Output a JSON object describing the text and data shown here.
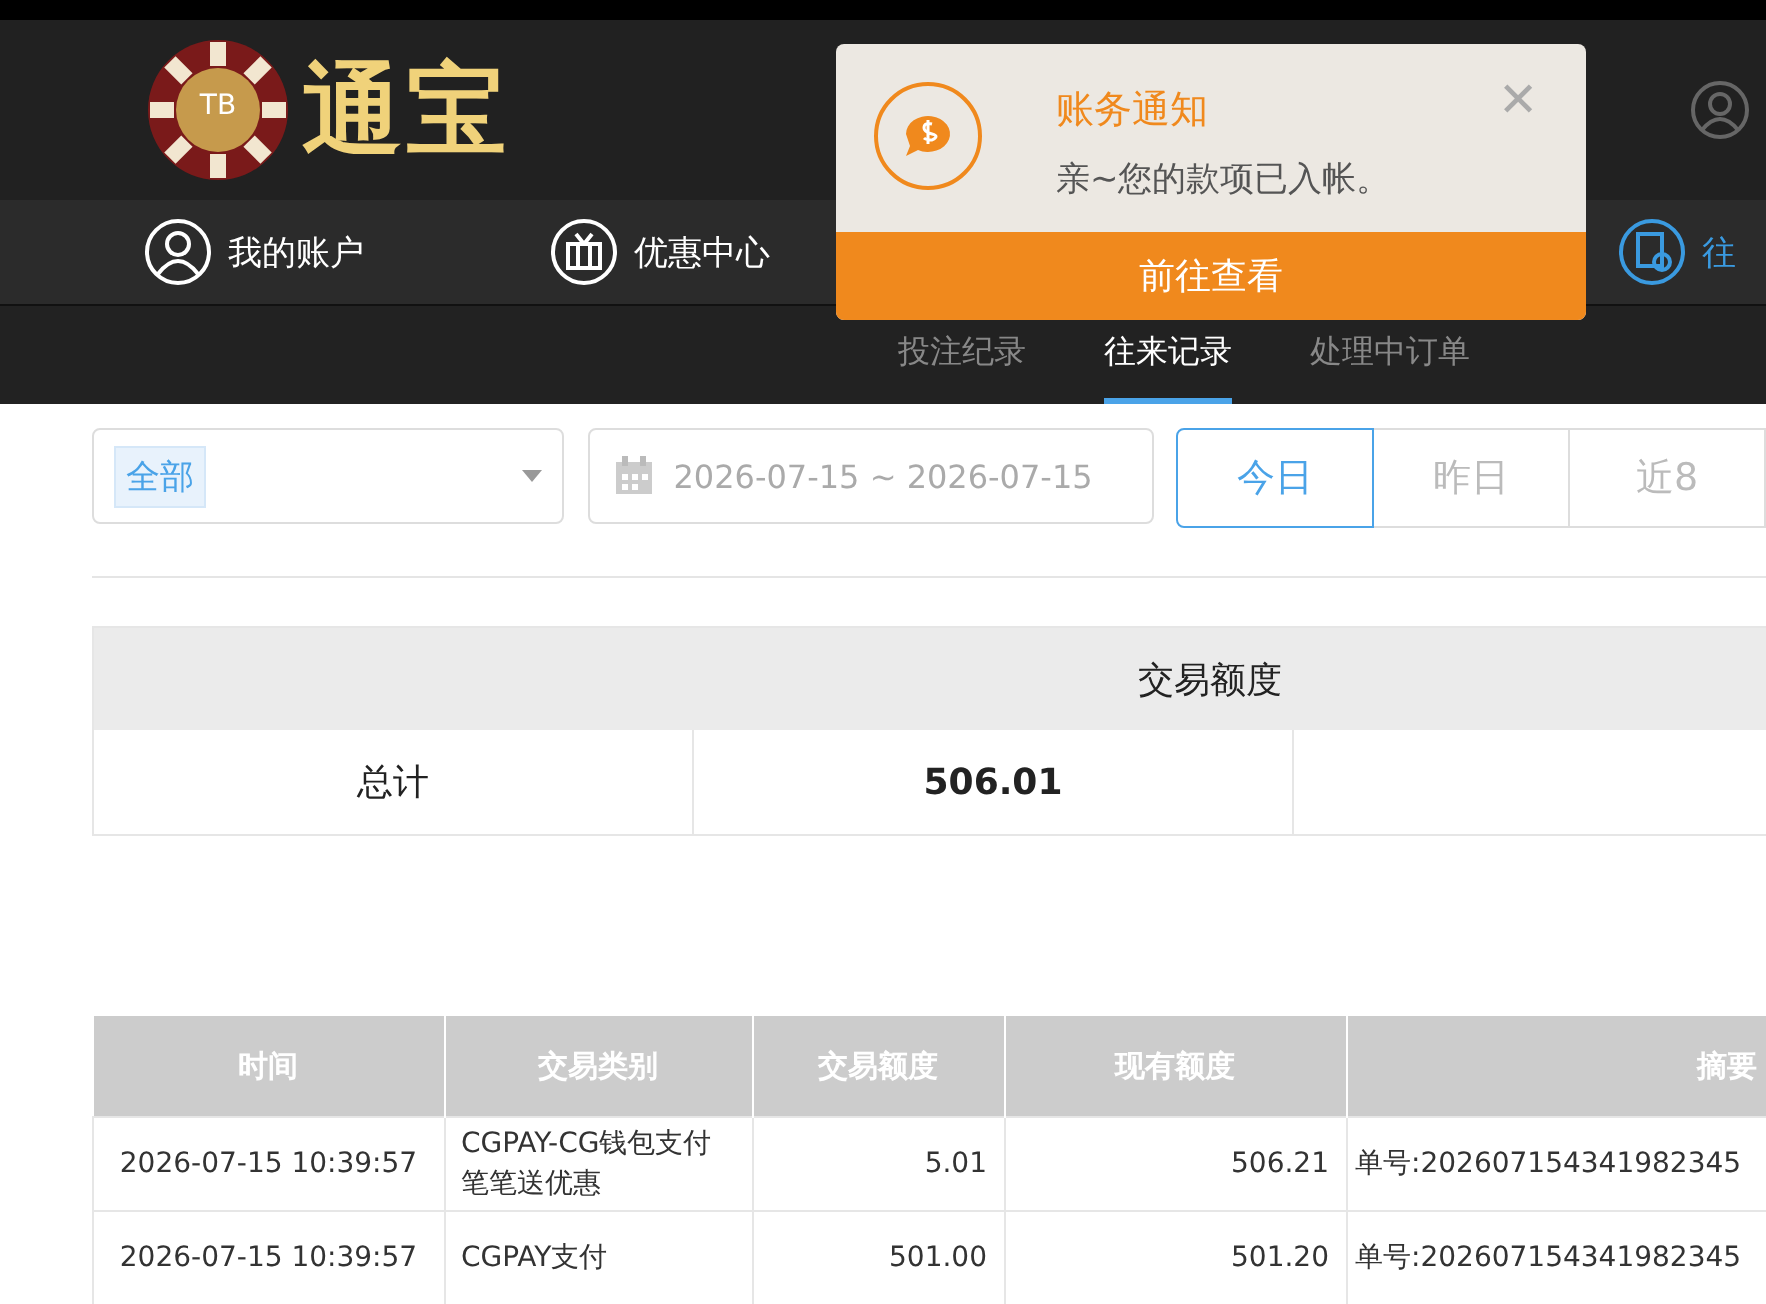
{
  "header": {
    "logo_badge": "TB",
    "logo_text": "通宝"
  },
  "nav": [
    {
      "label": "我的账户",
      "selected": false
    },
    {
      "label": "优惠中心",
      "selected": false
    },
    {
      "label": "往",
      "selected": true
    }
  ],
  "notification": {
    "title": "账务通知",
    "message": "亲~您的款项已入帐。",
    "close": "✕",
    "action": "前往查看"
  },
  "subtabs": [
    {
      "label": "投注纪录",
      "selected": false
    },
    {
      "label": "往来记录",
      "selected": true
    },
    {
      "label": "处理中订单",
      "selected": false
    }
  ],
  "filters": {
    "type_tag": "全部",
    "date_range": "2026-07-15 ~ 2026-07-15",
    "quick": [
      {
        "label": "今日",
        "selected": true
      },
      {
        "label": "昨日",
        "selected": false
      },
      {
        "label": "近8",
        "selected": false
      }
    ]
  },
  "summary": {
    "header": "交易额度",
    "label": "总计",
    "value": "506.01"
  },
  "table": {
    "columns": [
      "时间",
      "交易类别",
      "交易额度",
      "现有额度",
      "摘要"
    ],
    "rows": [
      [
        "2026-07-15 10:39:57",
        "CGPAY-CG钱包支付笔笔送优惠",
        "5.01",
        "506.21",
        "单号:202607154341982345"
      ],
      [
        "2026-07-15 10:39:57",
        "CGPAY支付",
        "501.00",
        "501.20",
        "单号:202607154341982345"
      ]
    ]
  }
}
